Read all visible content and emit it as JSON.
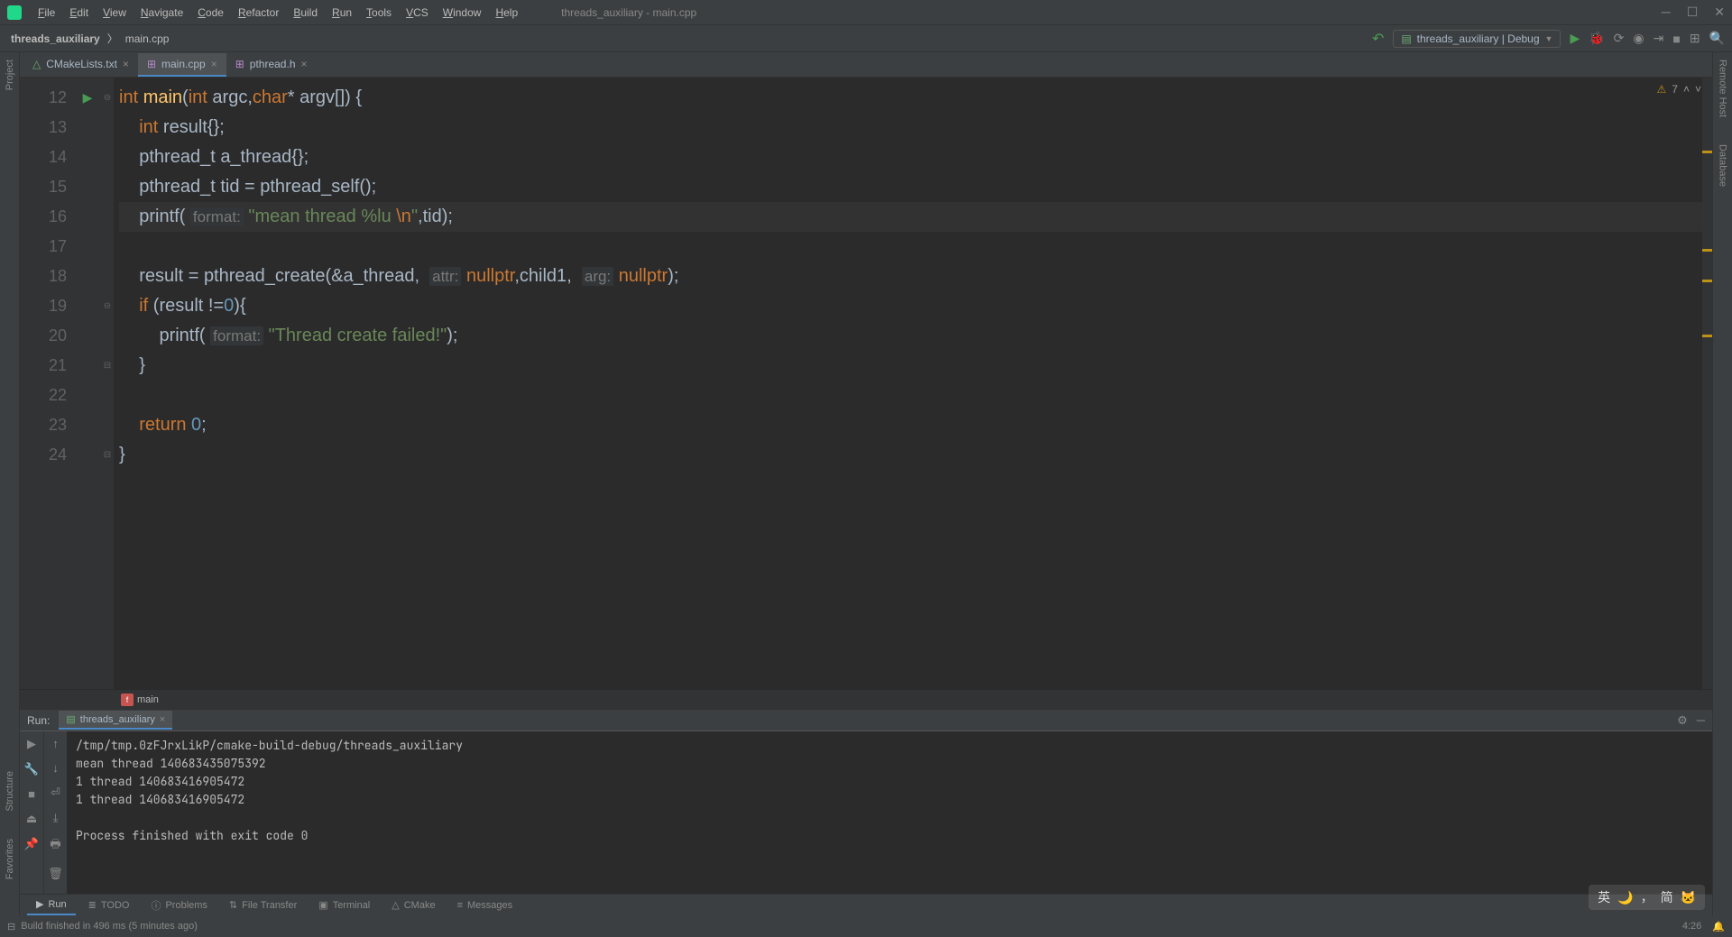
{
  "window": {
    "title": "threads_auxiliary - main.cpp"
  },
  "menus": [
    "File",
    "Edit",
    "View",
    "Navigate",
    "Code",
    "Refactor",
    "Build",
    "Run",
    "Tools",
    "VCS",
    "Window",
    "Help"
  ],
  "breadcrumbs": {
    "project": "threads_auxiliary",
    "file": "main.cpp"
  },
  "run_config": {
    "name": "threads_auxiliary | Debug"
  },
  "tabs": [
    {
      "name": "CMakeLists.txt",
      "active": false
    },
    {
      "name": "main.cpp",
      "active": true
    },
    {
      "name": "pthread.h",
      "active": false
    }
  ],
  "gutter": {
    "start": 12,
    "end": 24
  },
  "inspection": {
    "icon": "⚠",
    "count": "7"
  },
  "code_lines": [
    {
      "n": 12,
      "run": true,
      "html": "<span class='kw'>int</span> <span class='fn'>main</span>(<span class='kw'>int</span> <span class='id'>argc</span>,<span class='kw'>char</span>* <span class='id'>argv</span>[]) {"
    },
    {
      "n": 13,
      "html": "    <span class='kw'>int</span> <span class='id'>result</span>{};"
    },
    {
      "n": 14,
      "html": "    <span class='id'>pthread_t</span> <span class='id'>a_thread</span>{};"
    },
    {
      "n": 15,
      "html": "    <span class='id'>pthread_t</span> <span class='id'>tid</span> = <span class='id'>pthread_self</span>();"
    },
    {
      "n": 16,
      "hl": true,
      "html": "    <span class='id'>printf</span>( <span class='hint'>format:</span> <span class='str'>\"mean thread %lu </span><span class='esc'>\\n</span><span class='str'>\"</span>,<span class='id'>tid</span>);"
    },
    {
      "n": 17,
      "html": ""
    },
    {
      "n": 18,
      "html": "    <span class='id'>result</span> = <span class='id'>pthread_create</span>(&<span class='id'>a_thread</span>,  <span class='hint'>attr:</span> <span class='kw'>nullptr</span>,<span class='id'>child1</span>,  <span class='hint'>arg:</span> <span class='kw'>nullptr</span>);"
    },
    {
      "n": 19,
      "html": "    <span class='kw'>if</span> (<span class='id'>result</span> !=<span class='num'>0</span>){"
    },
    {
      "n": 20,
      "html": "        <span class='id'>printf</span>( <span class='hint'>format:</span> <span class='str'>\"Thread create failed!\"</span>);"
    },
    {
      "n": 21,
      "html": "    }"
    },
    {
      "n": 22,
      "html": ""
    },
    {
      "n": 23,
      "html": "    <span class='kw'>return</span> <span class='num'>0</span>;"
    },
    {
      "n": 24,
      "html": "}"
    }
  ],
  "breadcrumb_fn": "main",
  "run_panel": {
    "label": "Run:",
    "tab": "threads_auxiliary",
    "console": [
      "/tmp/tmp.0zFJrxLikP/cmake-build-debug/threads_auxiliary",
      "mean thread 140683435075392",
      "1 thread 140683416905472",
      "1 thread 140683416905472 ",
      "",
      "Process finished with exit code 0"
    ]
  },
  "bottom_tabs": [
    {
      "icon": "▶",
      "label": "Run",
      "active": true
    },
    {
      "icon": "≣",
      "label": "TODO"
    },
    {
      "icon": "ⓘ",
      "label": "Problems"
    },
    {
      "icon": "⇅",
      "label": "File Transfer"
    },
    {
      "icon": "▣",
      "label": "Terminal"
    },
    {
      "icon": "△",
      "label": "CMake"
    },
    {
      "icon": "≡",
      "label": "Messages"
    }
  ],
  "status": {
    "msg": "Build finished in 496 ms (5 minutes ago)",
    "time": "4:26"
  },
  "left_tools": [
    "Project"
  ],
  "left_tools_bottom": [
    "Structure",
    "Favorites"
  ],
  "right_tools": [
    "Remote Host",
    "Database"
  ],
  "overlay": {
    "lang1": "英",
    "lang2": "简"
  }
}
